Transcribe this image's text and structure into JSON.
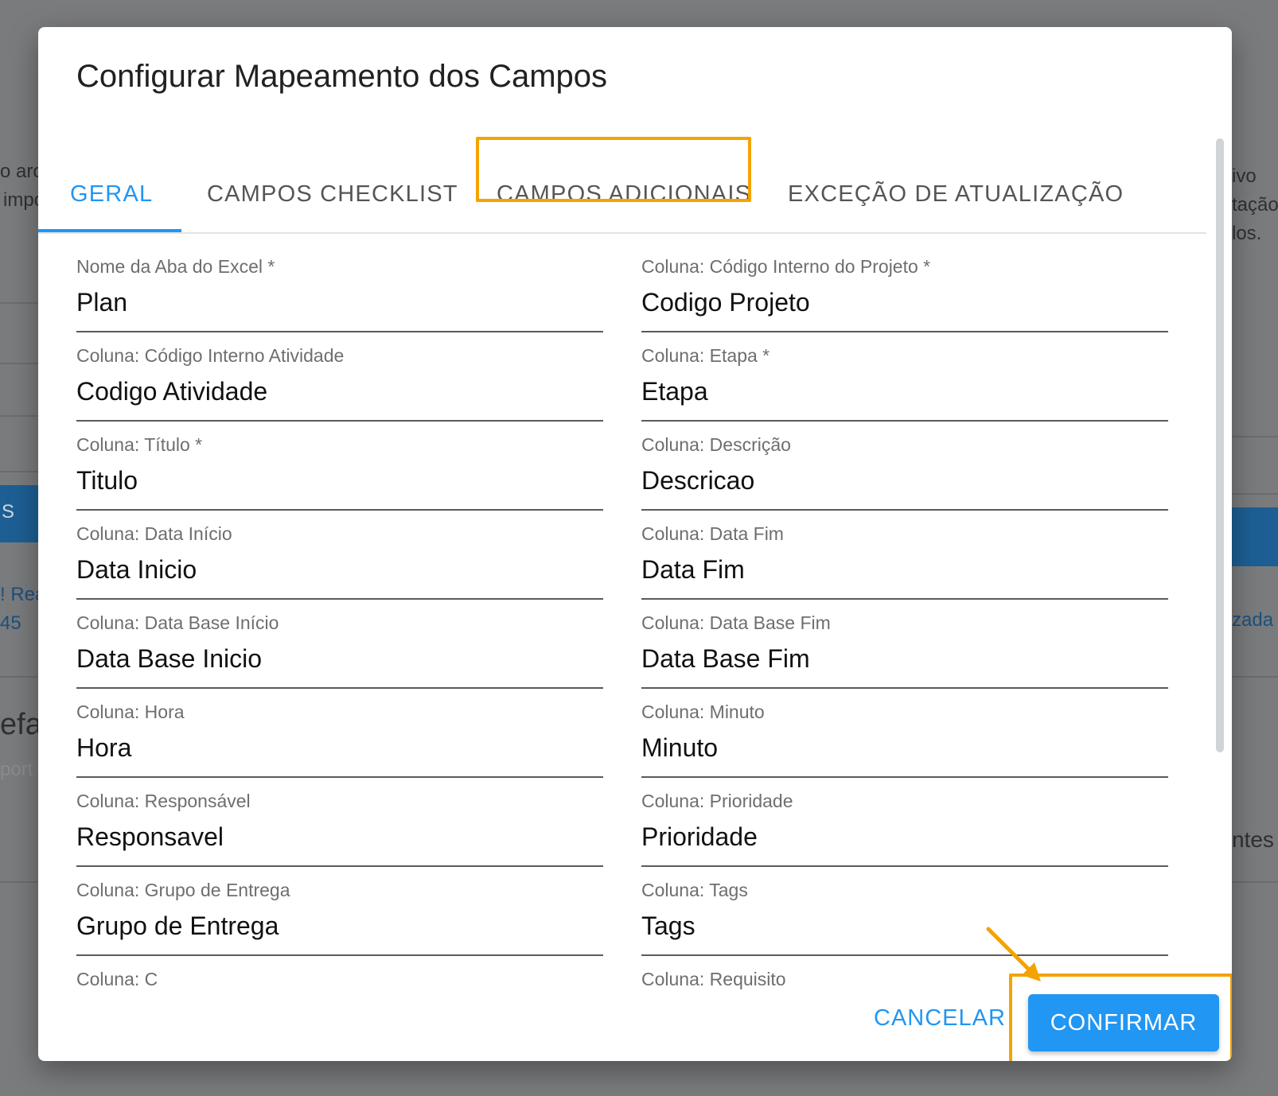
{
  "background": {
    "left_fragments": [
      "o arc",
      "impo",
      "S",
      "! Rea",
      "45",
      "efa",
      "port"
    ],
    "right_fragments": [
      "ivo",
      "tação",
      "los.",
      "zada",
      "ntes"
    ]
  },
  "dialog": {
    "title": "Configurar Mapeamento dos Campos",
    "tabs": [
      {
        "label": "GERAL",
        "active": true
      },
      {
        "label": "CAMPOS CHECKLIST",
        "active": false
      },
      {
        "label": "CAMPOS ADICIONAIS",
        "active": false,
        "highlighted": true
      },
      {
        "label": "EXCEÇÃO DE ATUALIZAÇÃO",
        "active": false
      }
    ],
    "fields_left": [
      {
        "label": "Nome da Aba do Excel *",
        "value": "Plan"
      },
      {
        "label": "Coluna: Código Interno Atividade",
        "value": "Codigo Atividade"
      },
      {
        "label": "Coluna: Título *",
        "value": "Titulo"
      },
      {
        "label": "Coluna: Data Início",
        "value": "Data Inicio"
      },
      {
        "label": "Coluna: Data Base Início",
        "value": "Data Base Inicio"
      },
      {
        "label": "Coluna: Hora",
        "value": "Hora"
      },
      {
        "label": "Coluna: Responsável",
        "value": "Responsavel"
      },
      {
        "label": "Coluna: Grupo de Entrega",
        "value": "Grupo de Entrega"
      },
      {
        "label": "Coluna: C",
        "value": ""
      }
    ],
    "fields_right": [
      {
        "label": "Coluna: Código Interno do Projeto *",
        "value": "Codigo Projeto"
      },
      {
        "label": "Coluna: Etapa *",
        "value": "Etapa"
      },
      {
        "label": "Coluna: Descrição",
        "value": "Descricao"
      },
      {
        "label": "Coluna: Data Fim",
        "value": "Data Fim"
      },
      {
        "label": "Coluna: Data Base Fim",
        "value": "Data Base Fim"
      },
      {
        "label": "Coluna: Minuto",
        "value": "Minuto"
      },
      {
        "label": "Coluna: Prioridade",
        "value": "Prioridade"
      },
      {
        "label": "Coluna: Tags",
        "value": "Tags"
      },
      {
        "label": "Coluna: Requisito",
        "value": ""
      }
    ],
    "actions": {
      "cancel_label": "CANCELAR",
      "confirm_label": "CONFIRMAR"
    }
  },
  "colors": {
    "accent": "#2196f3",
    "highlight": "#f4a300"
  }
}
